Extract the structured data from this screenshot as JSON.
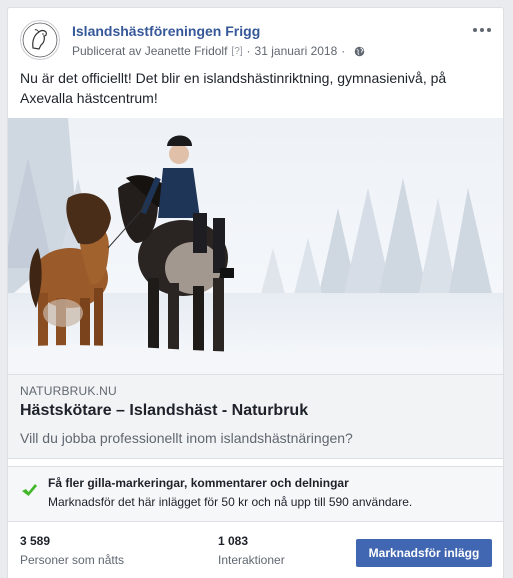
{
  "post": {
    "page_name": "Islandshästföreningen Frigg",
    "published_by": "Publicerat av Jeanette Fridolf",
    "help_marker": "[?]",
    "separator": "·",
    "date": "31 januari 2018",
    "audience_icon": "globe-icon",
    "menu_icon": "more-options-icon",
    "text": "Nu är det officiellt! Det blir en islandshästinriktning, gymnasienivå, på Axevalla hästcentrum!"
  },
  "link_preview": {
    "domain": "NATURBRUK.NU",
    "title": "Hästskötare – Islandshäst - Naturbruk",
    "description": "Vill du jobba professionellt inom islandshästnäringen?"
  },
  "promotion": {
    "icon": "checkmark-icon",
    "title": "Få fler gilla-markeringar, kommentarer och delningar",
    "subtitle": "Marknadsför det här inlägget för 50 kr och nå upp till 590 användare."
  },
  "stats": {
    "reach_value": "3 589",
    "reach_label": "Personer som nåtts",
    "engagement_value": "1 083",
    "engagement_label": "Interaktioner"
  },
  "boost_button_label": "Marknadsför inlägg",
  "colors": {
    "link_blue": "#365899",
    "button_blue": "#4267b2",
    "check_green": "#42b72a"
  }
}
